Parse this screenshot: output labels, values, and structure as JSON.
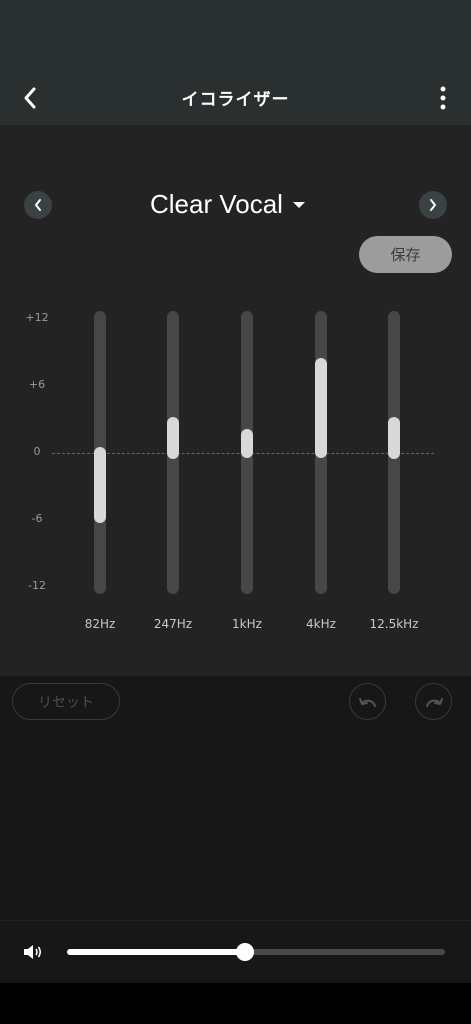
{
  "header": {
    "title": "イコライザー"
  },
  "preset": {
    "name": "Clear Vocal"
  },
  "save_label": "保存",
  "reset_label": "リセット",
  "equalizer": {
    "db_scale": [
      "+12",
      "+6",
      "0",
      "-6",
      "-12"
    ],
    "range_db": [
      -12,
      12
    ],
    "bands": [
      {
        "label": "82Hz",
        "gain_db": -6
      },
      {
        "label": "247Hz",
        "gain_db": 3
      },
      {
        "label": "1kHz",
        "gain_db": 2
      },
      {
        "label": "4kHz",
        "gain_db": 8
      },
      {
        "label": "12.5kHz",
        "gain_db": 3
      }
    ]
  },
  "volume": {
    "level": 0.47
  },
  "colors": {
    "app_bar": "#2a2f30",
    "panel": "#232323",
    "knob": "#d8d8d8",
    "track": "#474747"
  }
}
